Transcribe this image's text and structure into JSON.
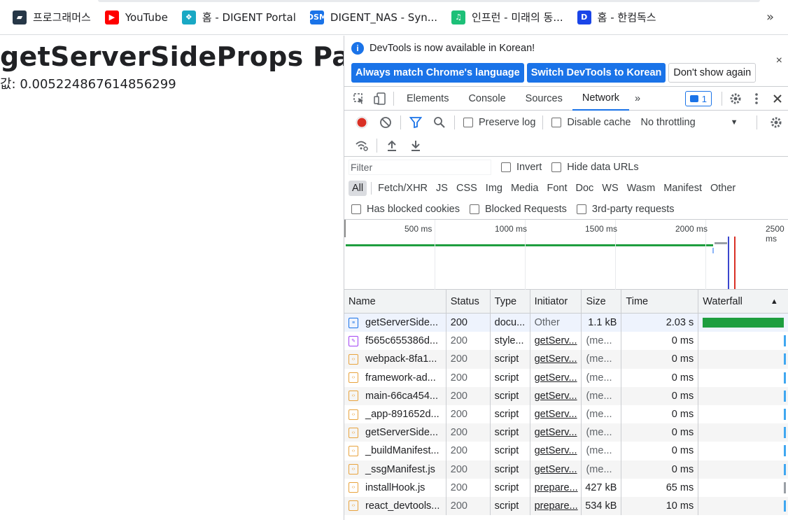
{
  "bookmarks": [
    {
      "label": "프로그래머스",
      "icon": "programmers-icon",
      "color": "#263747",
      "glyph": "▰"
    },
    {
      "label": "YouTube",
      "icon": "youtube-icon",
      "color": "#ff0000",
      "glyph": "▶"
    },
    {
      "label": "홈 - DIGENT Portal",
      "icon": "digent-portal-icon",
      "color": "#19a8c4",
      "glyph": "❖"
    },
    {
      "label": "DIGENT_NAS - Syn...",
      "icon": "dsm-icon",
      "color": "#1a73e8",
      "glyph": "DSM"
    },
    {
      "label": "인프런 - 미래의 동...",
      "icon": "inflearn-icon",
      "color": "#1dc078",
      "glyph": "♫"
    },
    {
      "label": "홈 - 한컴독스",
      "icon": "hancom-docs-icon",
      "color": "#1a45e8",
      "glyph": "D"
    }
  ],
  "bookmarks_more": "»",
  "page": {
    "title": "getServerSideProps Page",
    "value_line": "값: 0.005224867614856299"
  },
  "devtools": {
    "infobar": {
      "message": "DevTools is now available in Korean!",
      "btn_match": "Always match Chrome's language",
      "btn_switch": "Switch DevTools to Korean",
      "btn_dont": "Don't show again",
      "close": "×"
    },
    "tabs": [
      "Elements",
      "Console",
      "Sources",
      "Network"
    ],
    "active_tab": "Network",
    "more_tabs": "»",
    "issues_count": "1",
    "toolbar": {
      "preserve_log": "Preserve log",
      "disable_cache": "Disable cache",
      "throttling": "No throttling"
    },
    "filter": {
      "placeholder": "Filter",
      "invert": "Invert",
      "hide_data_urls": "Hide data URLs"
    },
    "types": [
      "All",
      "Fetch/XHR",
      "JS",
      "CSS",
      "Img",
      "Media",
      "Font",
      "Doc",
      "WS",
      "Wasm",
      "Manifest",
      "Other"
    ],
    "active_type": "All",
    "blocked": {
      "has_blocked_cookies": "Has blocked cookies",
      "blocked_requests": "Blocked Requests",
      "third_party": "3rd-party requests"
    },
    "overview_ticks": [
      "500 ms",
      "1000 ms",
      "1500 ms",
      "2000 ms",
      "2500 ms"
    ],
    "columns": [
      "Name",
      "Status",
      "Type",
      "Initiator",
      "Size",
      "Time",
      "Waterfall"
    ],
    "rows": [
      {
        "name": "getServerSide...",
        "status": "200",
        "type": "docu...",
        "initiator": "Other",
        "size": "1.1 kB",
        "time": "2.03 s",
        "kind": "doc"
      },
      {
        "name": "f565c655386d...",
        "status": "200",
        "type": "style...",
        "initiator": "getServ...",
        "size": "(me...",
        "time": "0 ms",
        "kind": "css"
      },
      {
        "name": "webpack-8fa1...",
        "status": "200",
        "type": "script",
        "initiator": "getServ...",
        "size": "(me...",
        "time": "0 ms",
        "kind": "js"
      },
      {
        "name": "framework-ad...",
        "status": "200",
        "type": "script",
        "initiator": "getServ...",
        "size": "(me...",
        "time": "0 ms",
        "kind": "js"
      },
      {
        "name": "main-66ca454...",
        "status": "200",
        "type": "script",
        "initiator": "getServ...",
        "size": "(me...",
        "time": "0 ms",
        "kind": "js"
      },
      {
        "name": "_app-891652d...",
        "status": "200",
        "type": "script",
        "initiator": "getServ...",
        "size": "(me...",
        "time": "0 ms",
        "kind": "js"
      },
      {
        "name": "getServerSide...",
        "status": "200",
        "type": "script",
        "initiator": "getServ...",
        "size": "(me...",
        "time": "0 ms",
        "kind": "js"
      },
      {
        "name": "_buildManifest...",
        "status": "200",
        "type": "script",
        "initiator": "getServ...",
        "size": "(me...",
        "time": "0 ms",
        "kind": "js"
      },
      {
        "name": "_ssgManifest.js",
        "status": "200",
        "type": "script",
        "initiator": "getServ...",
        "size": "(me...",
        "time": "0 ms",
        "kind": "js"
      },
      {
        "name": "installHook.js",
        "status": "200",
        "type": "script",
        "initiator": "prepare...",
        "size": "427 kB",
        "time": "65 ms",
        "kind": "js"
      },
      {
        "name": "react_devtools...",
        "status": "200",
        "type": "script",
        "initiator": "prepare...",
        "size": "534 kB",
        "time": "10 ms",
        "kind": "js"
      }
    ]
  }
}
